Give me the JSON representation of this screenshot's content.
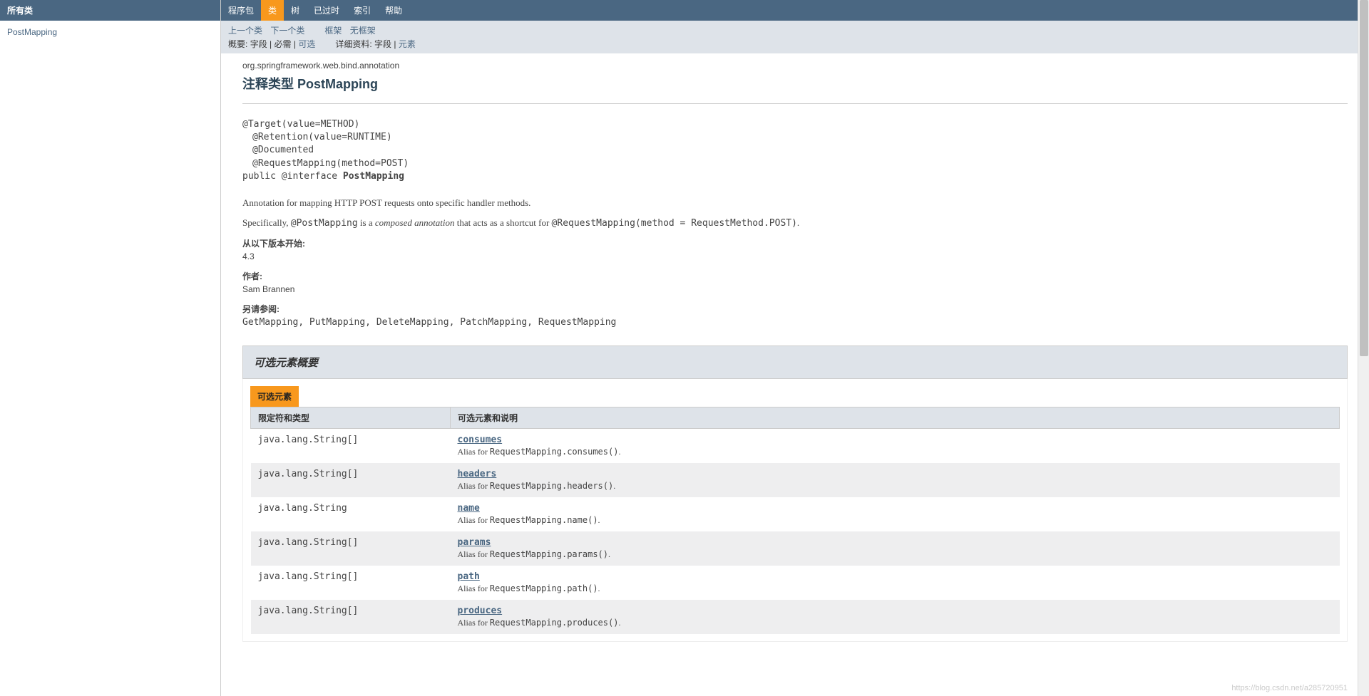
{
  "sidebar": {
    "header": "所有类",
    "link": "PostMapping"
  },
  "topnav": [
    "程序包",
    "类",
    "树",
    "已过时",
    "索引",
    "帮助"
  ],
  "topnav_active_index": 1,
  "subnav": {
    "row1": [
      "上一个类",
      "下一个类",
      "框架",
      "无框架"
    ],
    "row2_prefix": "概要:",
    "row2_items": [
      "字段",
      "必需",
      "可选"
    ],
    "row2b_prefix": "详细资料:",
    "row2b_items": [
      "字段",
      "元素"
    ]
  },
  "header": {
    "package": "org.springframework.web.bind.annotation",
    "title": "注释类型 PostMapping"
  },
  "signature": {
    "line1": "@Target(value=METHOD)",
    "line2": "@Retention(value=RUNTIME)",
    "line3": "@Documented",
    "line4": "@RequestMapping(method=POST)",
    "line5a": "public @interface ",
    "line5b": "PostMapping"
  },
  "description": {
    "p1": "Annotation for mapping HTTP POST requests onto specific handler methods.",
    "p2a": "Specifically, ",
    "p2b": "@PostMapping",
    "p2c": " is a ",
    "p2d": "composed annotation",
    "p2e": " that acts as a shortcut for ",
    "p2f": "@RequestMapping(method = RequestMethod.POST)",
    "p2g": "."
  },
  "since": {
    "label": "从以下版本开始:",
    "value": "4.3"
  },
  "author": {
    "label": "作者:",
    "value": "Sam Brannen"
  },
  "seealso": {
    "label": "另请参阅:",
    "value": "GetMapping, PutMapping, DeleteMapping, PatchMapping, RequestMapping"
  },
  "summary": {
    "title": "可选元素概要",
    "caption": "可选元素",
    "col1": "限定符和类型",
    "col2": "可选元素和说明",
    "rows": [
      {
        "type": "java.lang.String[]",
        "name": "consumes",
        "desc_a": "Alias for ",
        "desc_b": "RequestMapping.consumes()",
        "desc_c": "."
      },
      {
        "type": "java.lang.String[]",
        "name": "headers",
        "desc_a": "Alias for ",
        "desc_b": "RequestMapping.headers()",
        "desc_c": "."
      },
      {
        "type": "java.lang.String",
        "name": "name",
        "desc_a": "Alias for ",
        "desc_b": "RequestMapping.name()",
        "desc_c": "."
      },
      {
        "type": "java.lang.String[]",
        "name": "params",
        "desc_a": "Alias for ",
        "desc_b": "RequestMapping.params()",
        "desc_c": "."
      },
      {
        "type": "java.lang.String[]",
        "name": "path",
        "desc_a": "Alias for ",
        "desc_b": "RequestMapping.path()",
        "desc_c": "."
      },
      {
        "type": "java.lang.String[]",
        "name": "produces",
        "desc_a": "Alias for ",
        "desc_b": "RequestMapping.produces()",
        "desc_c": "."
      }
    ]
  },
  "watermark": "https://blog.csdn.net/a285720951"
}
